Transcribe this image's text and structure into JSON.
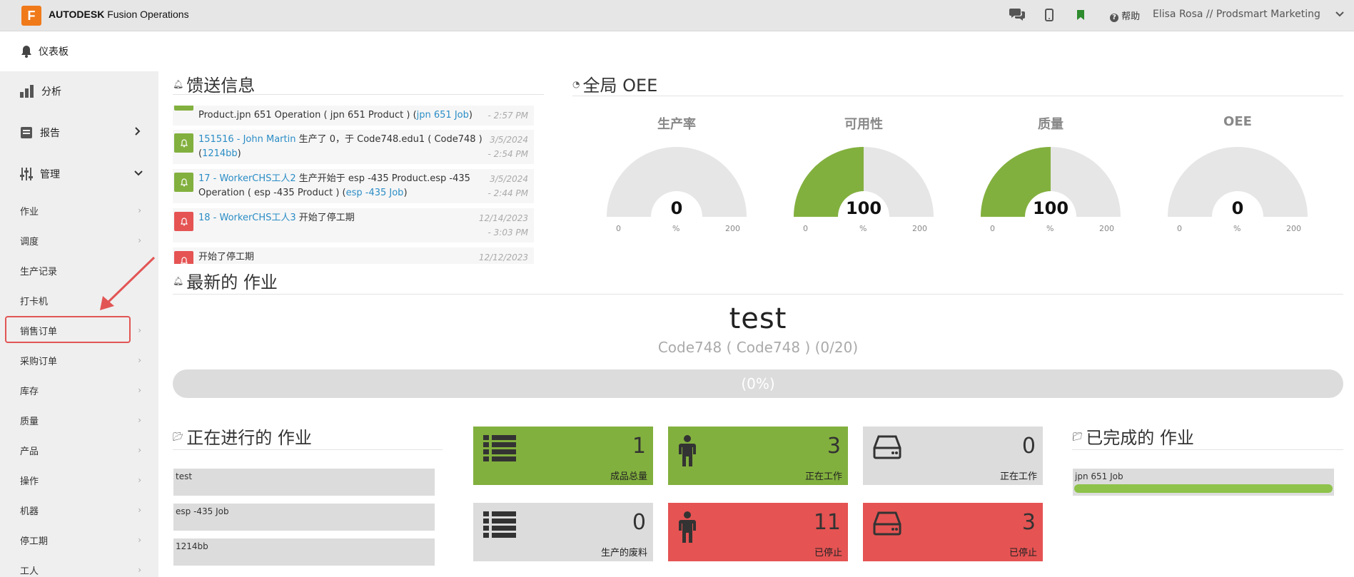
{
  "header": {
    "logo_letter": "F",
    "brand_bold": "AUTODESK",
    "brand_rest": "Fusion Operations",
    "help_label": "帮助",
    "user_label": "Elisa Rosa // Prodsmart Marketing",
    "icons": [
      "chat-icon",
      "mobile-icon",
      "bookmark-icon",
      "help-icon",
      "chevron-down-icon"
    ]
  },
  "subheader": {
    "title": "仪表板"
  },
  "sidebar": {
    "main": [
      {
        "label": "分析",
        "icon": "bar-chart-icon"
      },
      {
        "label": "报告",
        "icon": "report-icon"
      },
      {
        "label": "管理",
        "icon": "sliders-icon"
      }
    ],
    "items": [
      {
        "label": "作业"
      },
      {
        "label": "调度"
      },
      {
        "label": "生产记录"
      },
      {
        "label": "打卡机"
      },
      {
        "label": "销售订单"
      },
      {
        "label": "采购订单"
      },
      {
        "label": "库存"
      },
      {
        "label": "质量"
      },
      {
        "label": "产品"
      },
      {
        "label": "操作"
      },
      {
        "label": "机器"
      },
      {
        "label": "停工期"
      },
      {
        "label": "工人"
      }
    ]
  },
  "feed": {
    "title": "馈送信息",
    "entries": [
      {
        "color": "green",
        "link1": "",
        "text1": "Product.jpn 651 Operation ( jpn 651 Product ) (",
        "link2": "jpn 651 Job",
        "text2": ")",
        "date": "",
        "time": "- 2:57 PM"
      },
      {
        "color": "green",
        "link1": "151516 - John Martin",
        "text1": " 生产了 0，于 Code748.edu1 ( Code748 ) (",
        "link2": "1214bb",
        "text2": ")",
        "date": "3/5/2024",
        "time": "- 2:54 PM"
      },
      {
        "color": "green",
        "link1": "17 - WorkerCHS工人2",
        "text1": " 生产开始于 esp -435 Product.esp -435 Operation ( esp -435 Product ) (",
        "link2": "esp -435 Job",
        "text2": ")",
        "date": "3/5/2024",
        "time": "- 2:44 PM"
      },
      {
        "color": "red",
        "link1": "18 - WorkerCHS工人3",
        "text1": " 开始了停工期",
        "link2": "",
        "text2": "",
        "date": "12/14/2023",
        "time": "- 3:03 PM"
      },
      {
        "color": "red",
        "link1": "",
        "text1": "开始了停工期",
        "link2": "",
        "text2": "",
        "date": "12/12/2023",
        "time": ""
      }
    ]
  },
  "oee": {
    "title": "全局 OEE",
    "gauges": [
      {
        "label": "生产率",
        "value": "0",
        "percent": 0,
        "unit": "%",
        "min": "0",
        "max": "200"
      },
      {
        "label": "可用性",
        "value": "100",
        "percent": 100,
        "unit": "%",
        "min": "0",
        "max": "200"
      },
      {
        "label": "质量",
        "value": "100",
        "percent": 100,
        "unit": "%",
        "min": "0",
        "max": "200"
      },
      {
        "label": "OEE",
        "value": "0",
        "percent": 0,
        "unit": "%",
        "min": "0",
        "max": "200"
      }
    ],
    "colors": {
      "fill": "#82b03e",
      "track": "#e6e6e6"
    }
  },
  "latest_job": {
    "title": "最新的 作业",
    "name": "test",
    "subtitle": "Code748 ( Code748 ) (0/20)",
    "progress_text": "(0%)",
    "progress": 0
  },
  "in_progress": {
    "title": "正在进行的 作业",
    "items": [
      "test",
      "esp -435 Job",
      "1214bb"
    ]
  },
  "tiles": [
    {
      "value": "1",
      "label": "成品总量",
      "color": "green",
      "icon": "list-icon"
    },
    {
      "value": "3",
      "label": "正在工作",
      "color": "green",
      "icon": "worker-icon"
    },
    {
      "value": "0",
      "label": "正在工作",
      "color": "grey",
      "icon": "machine-icon"
    },
    {
      "value": "0",
      "label": "生产的废料",
      "color": "grey",
      "icon": "list-icon"
    },
    {
      "value": "11",
      "label": "已停止",
      "color": "red",
      "icon": "worker-icon"
    },
    {
      "value": "3",
      "label": "已停止",
      "color": "red",
      "icon": "machine-icon"
    }
  ],
  "completed": {
    "title": "已完成的 作业",
    "items": [
      {
        "label": "jpn 651 Job",
        "progress": 1
      }
    ]
  }
}
